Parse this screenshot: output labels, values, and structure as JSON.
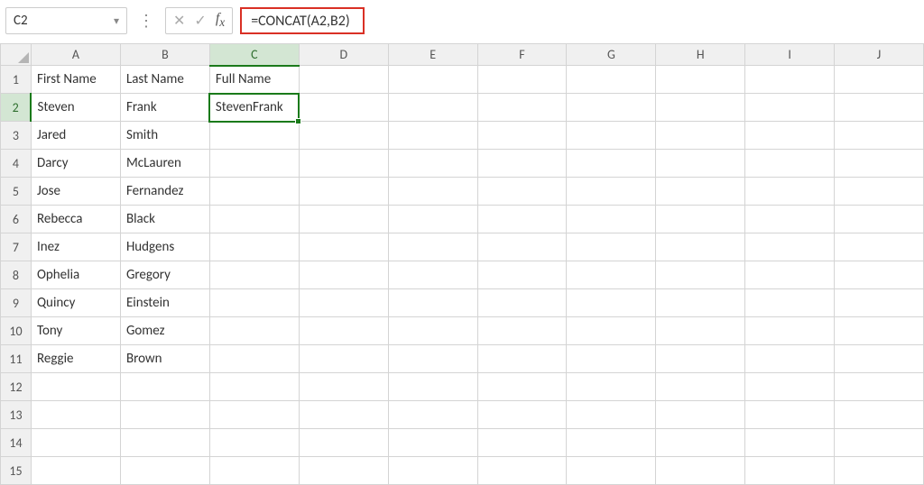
{
  "nameBox": {
    "value": "C2"
  },
  "formulaBar": {
    "formula": "=CONCAT(A2,B2)"
  },
  "columns": [
    "A",
    "B",
    "C",
    "D",
    "E",
    "F",
    "G",
    "H",
    "I",
    "J"
  ],
  "activeColIndex": 2,
  "activeRowIndex": 1,
  "rowCount": 15,
  "cells": {
    "A1": "First Name",
    "B1": "Last Name",
    "C1": "Full Name",
    "A2": "Steven",
    "B2": "Frank",
    "C2": "StevenFrank",
    "A3": "Jared",
    "B3": "Smith",
    "A4": "Darcy",
    "B4": "McLauren",
    "A5": "Jose",
    "B5": "Fernandez",
    "A6": "Rebecca",
    "B6": "Black",
    "A7": "Inez",
    "B7": "Hudgens",
    "A8": "Ophelia",
    "B8": "Gregory",
    "A9": "Quincy",
    "B9": "Einstein",
    "A10": "Tony",
    "B10": "Gomez",
    "A11": "Reggie",
    "B11": "Brown"
  }
}
